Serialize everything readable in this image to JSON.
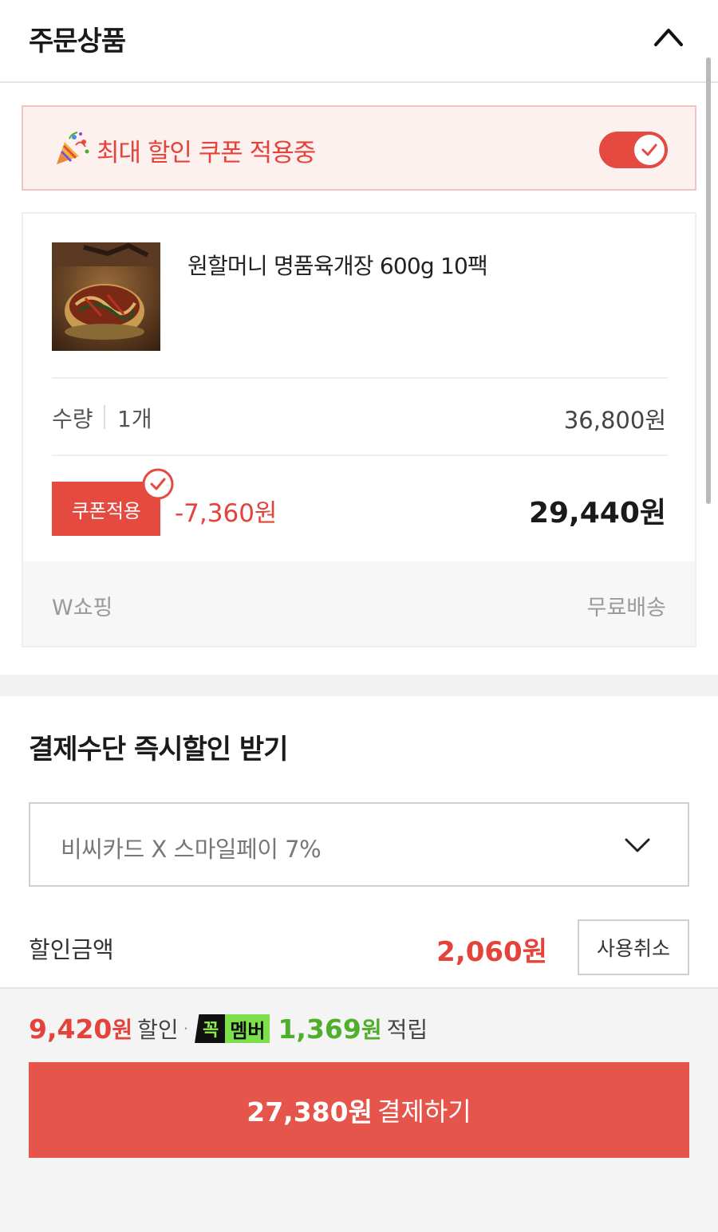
{
  "header": {
    "title": "주문상품"
  },
  "coupon_banner": {
    "text": "최대 할인 쿠폰 적용중",
    "toggle_on": true
  },
  "product": {
    "name": "원할머니 명품육개장 600g 10팩",
    "quantity_label": "수량",
    "quantity_value": "1개",
    "list_price": "36,800원",
    "coupon_button_label": "쿠폰적용",
    "coupon_discount": "-7,360원",
    "final_price": "29,440원",
    "seller": "W쇼핑",
    "shipping": "무료배송"
  },
  "payment": {
    "title": "결제수단 즉시할인 받기",
    "selected_card": "비씨카드 X 스마일페이 7%",
    "discount_label": "할인금액",
    "discount_value": "2,060원",
    "cancel_label": "사용취소"
  },
  "footer": {
    "total_discount_number": "9,420",
    "total_discount_unit": "원",
    "discount_word": "할인",
    "separator": "·",
    "member_badge_left": "꼭",
    "member_badge_right": "멤버",
    "points_number": "1,369",
    "points_unit": "원",
    "points_word": "적립",
    "pay_amount": "27,380원",
    "pay_label": "결제하기"
  },
  "colors": {
    "accent_red": "#e54a40",
    "banner_bg": "#fdf1f0",
    "member_green": "#7de04a",
    "points_green": "#4fae2c"
  },
  "icons": {
    "header_toggle": "chevron-up-icon",
    "banner": "party-popper-icon",
    "toggle": "check-icon",
    "select": "chevron-down-icon"
  }
}
